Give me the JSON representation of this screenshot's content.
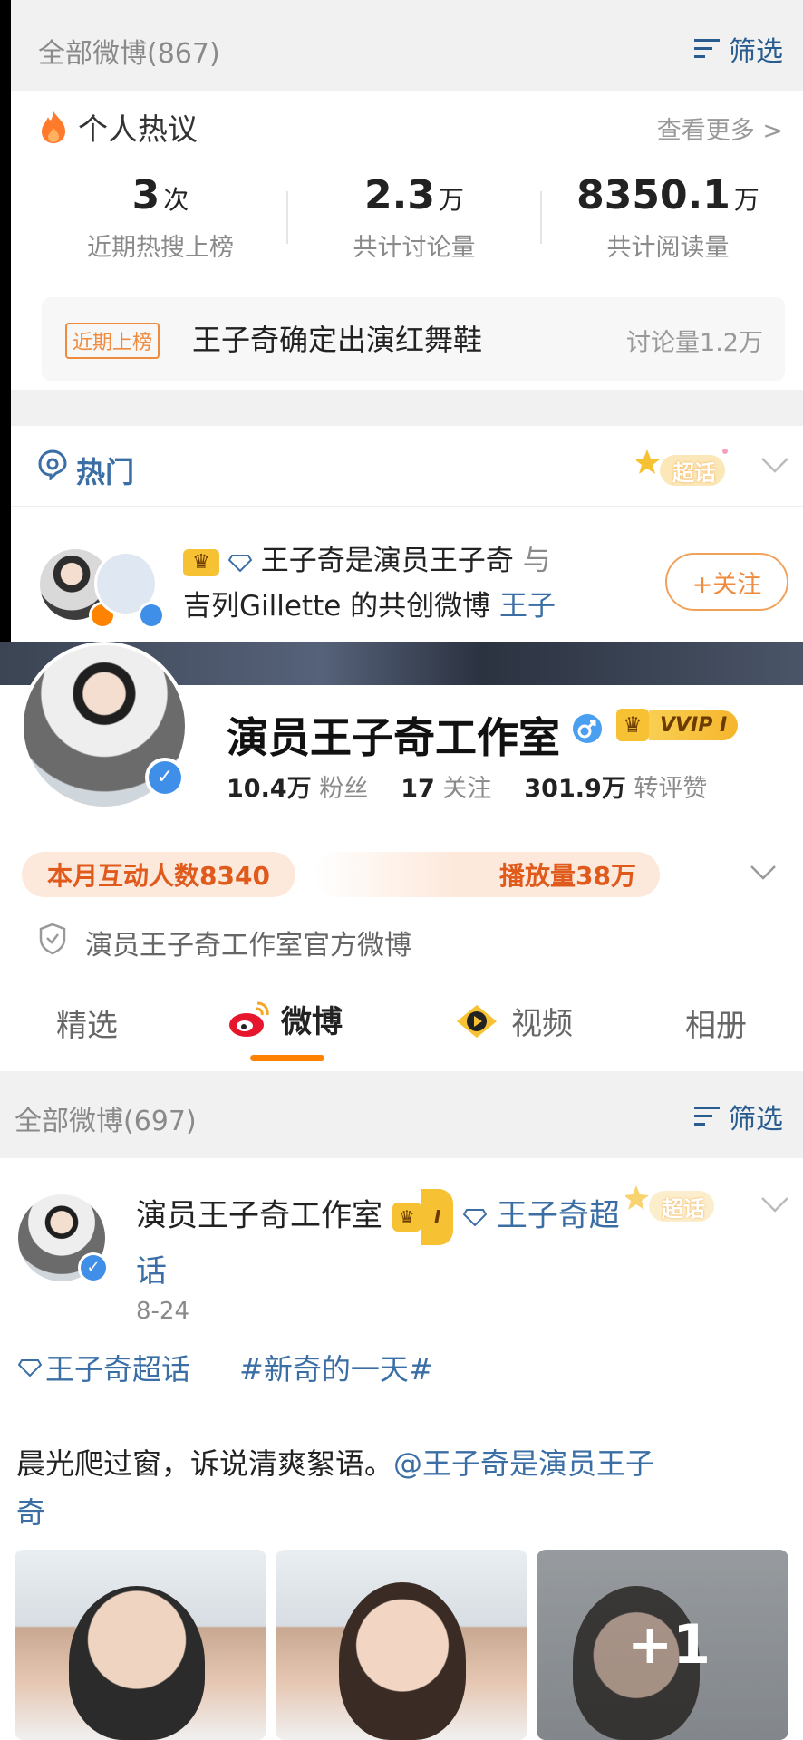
{
  "top": {
    "all_weibo_label": "全部微博(867)",
    "filter_label": "筛选",
    "hot_discussion": {
      "title": "个人热议",
      "more_label": "查看更多 >",
      "stats": [
        {
          "value": "3",
          "unit": "次",
          "label": "近期热搜上榜"
        },
        {
          "value": "2.3",
          "unit": "万",
          "label": "共计讨论量"
        },
        {
          "value": "8350.1",
          "unit": "万",
          "label": "共计阅读量"
        }
      ],
      "trend": {
        "tag": "近期上榜",
        "title": "王子奇确定出演红舞鞋",
        "count": "讨论量1.2万"
      }
    },
    "hot_section": {
      "title": "热门",
      "supertopic_badge": "超话"
    },
    "post_preview": {
      "author": "王子奇是演员王子奇",
      "connector": "与",
      "line2": "吉列Gillette 的共创微博",
      "link_fragment": "王子",
      "follow_label": "+关注"
    }
  },
  "profile": {
    "name": "演员王子奇工作室",
    "gender_icon": "male-icon",
    "vip_label": "VVIP I",
    "stats": [
      {
        "value": "10.4万",
        "label": "粉丝"
      },
      {
        "value": "17",
        "label": "关注"
      },
      {
        "value": "301.9万",
        "label": "转评赞"
      }
    ],
    "pill_interaction": "本月互动人数8340",
    "pill_play": "播放量38万",
    "verified_desc": "演员王子奇工作室官方微博",
    "tabs": [
      {
        "label": "精选"
      },
      {
        "label": "微博"
      },
      {
        "label": "视频"
      },
      {
        "label": "相册"
      }
    ]
  },
  "feed": {
    "all_weibo_label": "全部微博(697)",
    "filter_label": "筛选",
    "post": {
      "author": "演员王子奇工作室",
      "crown_label": "I",
      "topic_line1": "王子奇超",
      "topic_line2": "话",
      "supertopic_badge": "超话",
      "date": "8-24",
      "tag_supertopic": "王子奇超话",
      "tag_hashtag": "#新奇的一天#",
      "text": "晨光爬过窗，诉说清爽絮语。",
      "mention_line1": "@王子奇是演员王子",
      "mention_line2": "奇",
      "more_photos": "+1"
    }
  },
  "colors": {
    "accent_orange": "#ff8200",
    "link_blue": "#3a6ea5",
    "bg_gray": "#f1f1f1"
  }
}
